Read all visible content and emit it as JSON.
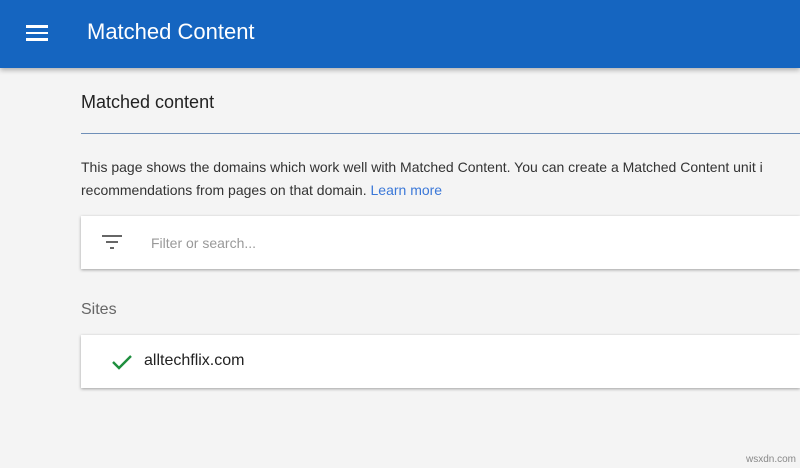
{
  "header": {
    "title": "Matched Content"
  },
  "page": {
    "heading": "Matched content",
    "description_line1": "This page shows the domains which work well with Matched Content. You can create a Matched Content unit i",
    "description_line2": "recommendations from pages on that domain.",
    "learn_more": "Learn more"
  },
  "search": {
    "placeholder": "Filter or search...",
    "value": ""
  },
  "sites": {
    "label": "Sites",
    "items": [
      {
        "domain": "alltechflix.com",
        "status": "check-icon",
        "status_color": "#1e8e3e"
      }
    ]
  },
  "watermark": "wsxdn.com"
}
